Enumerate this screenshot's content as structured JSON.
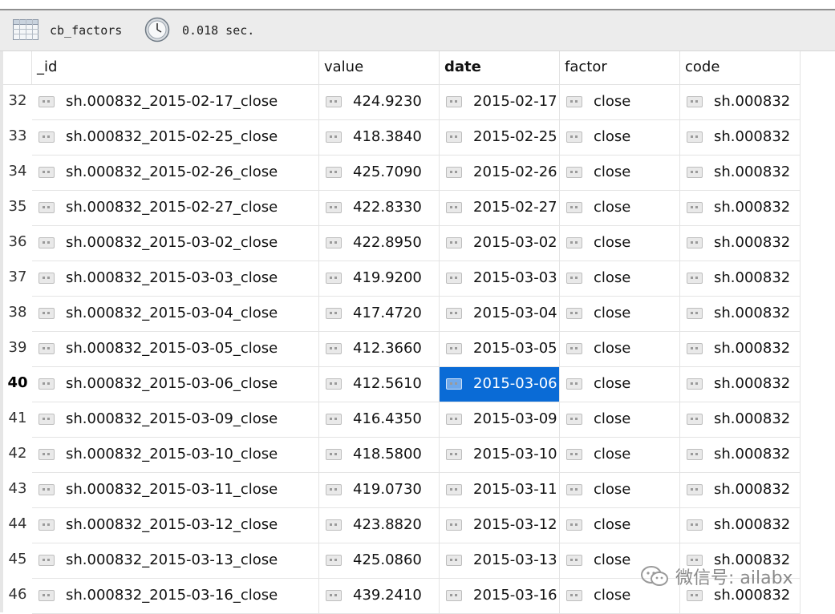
{
  "toolbar": {
    "table_name": "cb_factors",
    "query_time": "0.018 sec.",
    "icons": [
      "table-grid-icon",
      "clock-icon"
    ]
  },
  "columns": [
    "_id",
    "value",
    "date",
    "factor",
    "code"
  ],
  "active_column": "date",
  "active_row": "40",
  "rows": [
    {
      "n": "32",
      "_id": "sh.000832_2015-02-17_close",
      "value": "424.9230",
      "date": "2015-02-17",
      "factor": "close",
      "code": "sh.000832"
    },
    {
      "n": "33",
      "_id": "sh.000832_2015-02-25_close",
      "value": "418.3840",
      "date": "2015-02-25",
      "factor": "close",
      "code": "sh.000832"
    },
    {
      "n": "34",
      "_id": "sh.000832_2015-02-26_close",
      "value": "425.7090",
      "date": "2015-02-26",
      "factor": "close",
      "code": "sh.000832"
    },
    {
      "n": "35",
      "_id": "sh.000832_2015-02-27_close",
      "value": "422.8330",
      "date": "2015-02-27",
      "factor": "close",
      "code": "sh.000832"
    },
    {
      "n": "36",
      "_id": "sh.000832_2015-03-02_close",
      "value": "422.8950",
      "date": "2015-03-02",
      "factor": "close",
      "code": "sh.000832"
    },
    {
      "n": "37",
      "_id": "sh.000832_2015-03-03_close",
      "value": "419.9200",
      "date": "2015-03-03",
      "factor": "close",
      "code": "sh.000832"
    },
    {
      "n": "38",
      "_id": "sh.000832_2015-03-04_close",
      "value": "417.4720",
      "date": "2015-03-04",
      "factor": "close",
      "code": "sh.000832"
    },
    {
      "n": "39",
      "_id": "sh.000832_2015-03-05_close",
      "value": "412.3660",
      "date": "2015-03-05",
      "factor": "close",
      "code": "sh.000832"
    },
    {
      "n": "40",
      "_id": "sh.000832_2015-03-06_close",
      "value": "412.5610",
      "date": "2015-03-06",
      "factor": "close",
      "code": "sh.000832"
    },
    {
      "n": "41",
      "_id": "sh.000832_2015-03-09_close",
      "value": "416.4350",
      "date": "2015-03-09",
      "factor": "close",
      "code": "sh.000832"
    },
    {
      "n": "42",
      "_id": "sh.000832_2015-03-10_close",
      "value": "418.5800",
      "date": "2015-03-10",
      "factor": "close",
      "code": "sh.000832"
    },
    {
      "n": "43",
      "_id": "sh.000832_2015-03-11_close",
      "value": "419.0730",
      "date": "2015-03-11",
      "factor": "close",
      "code": "sh.000832"
    },
    {
      "n": "44",
      "_id": "sh.000832_2015-03-12_close",
      "value": "423.8820",
      "date": "2015-03-12",
      "factor": "close",
      "code": "sh.000832"
    },
    {
      "n": "45",
      "_id": "sh.000832_2015-03-13_close",
      "value": "425.0860",
      "date": "2015-03-13",
      "factor": "close",
      "code": "sh.000832"
    },
    {
      "n": "46",
      "_id": "sh.000832_2015-03-16_close",
      "value": "439.2410",
      "date": "2015-03-16",
      "factor": "close",
      "code": "sh.000832"
    }
  ],
  "watermark": {
    "text": "微信号: ailabx",
    "icon": "wechat-icon"
  },
  "colors": {
    "selection": "#0a6bd6",
    "toolbar_bg": "#ececec"
  }
}
